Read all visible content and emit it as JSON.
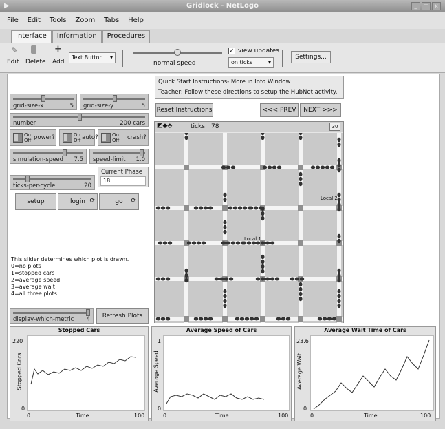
{
  "window": {
    "title": "Gridlock - NetLogo"
  },
  "menu": [
    "File",
    "Edit",
    "Tools",
    "Zoom",
    "Tabs",
    "Help"
  ],
  "tabs": [
    "Interface",
    "Information",
    "Procedures"
  ],
  "toolbar": {
    "edit_label": "Edit",
    "delete_label": "Delete",
    "add_label": "Add",
    "widget_type": "Text Button",
    "speed_label": "normal speed",
    "view_updates_label": "view updates",
    "update_mode": "on ticks",
    "settings_label": "Settings..."
  },
  "instructions": {
    "title": "Quick Start Instructions- More in Info Window",
    "text": "Teacher: Follow these directions to setup the HubNet activity.",
    "reset_label": "Reset Instructions",
    "prev_label": "<<< PREV",
    "next_label": "NEXT >>>"
  },
  "sliders": {
    "grid_size_x": {
      "label": "grid-size-x",
      "value": "5"
    },
    "grid_size_y": {
      "label": "grid-size-y",
      "value": "5"
    },
    "number": {
      "label": "number",
      "value": "200 cars"
    },
    "simulation_speed": {
      "label": "simulation-speed",
      "value": "7.5"
    },
    "speed_limit": {
      "label": "speed-limit",
      "value": "1.0"
    },
    "ticks_per_cycle": {
      "label": "ticks-per-cycle",
      "value": "20"
    },
    "display_which_metric": {
      "label": "display-which-metric",
      "value": "4"
    }
  },
  "switches": {
    "power": {
      "label": "power?",
      "on": "On",
      "off": "Off"
    },
    "auto": {
      "label": "auto?",
      "on": "On",
      "off": "Off"
    },
    "crash": {
      "label": "crash?",
      "on": "On",
      "off": "Off"
    }
  },
  "monitor": {
    "label": "Current Phase",
    "value": "18"
  },
  "buttons": {
    "setup": "setup",
    "login": "login",
    "go": "go",
    "refresh": "Refresh Plots"
  },
  "note": [
    "This slider determines which plot is drawn.",
    "0=no plots",
    "1=stopped cars",
    "2=average speed",
    "3=average wait",
    "4=all three plots"
  ],
  "view": {
    "ticks_label": "ticks",
    "ticks_value": "78",
    "speed_box": "30",
    "local_labels": [
      "Local 2",
      "Local 1"
    ]
  },
  "plots": [
    {
      "title": "Stopped Cars",
      "ylabel": "Stopped Cars",
      "xlabel": "Time",
      "ymax": "220",
      "ymin": "0",
      "xmin": "0",
      "xmax": "100"
    },
    {
      "title": "Average Speed of Cars",
      "ylabel": "Average Speed",
      "xlabel": "Time",
      "ymax": "1",
      "ymin": "0",
      "xmin": "0",
      "xmax": "100"
    },
    {
      "title": "Average Wait Time of Cars",
      "ylabel": "Average Wait",
      "xlabel": "Time",
      "ymax": "23.6",
      "ymin": "0",
      "xmin": "0",
      "xmax": "100"
    }
  ]
}
